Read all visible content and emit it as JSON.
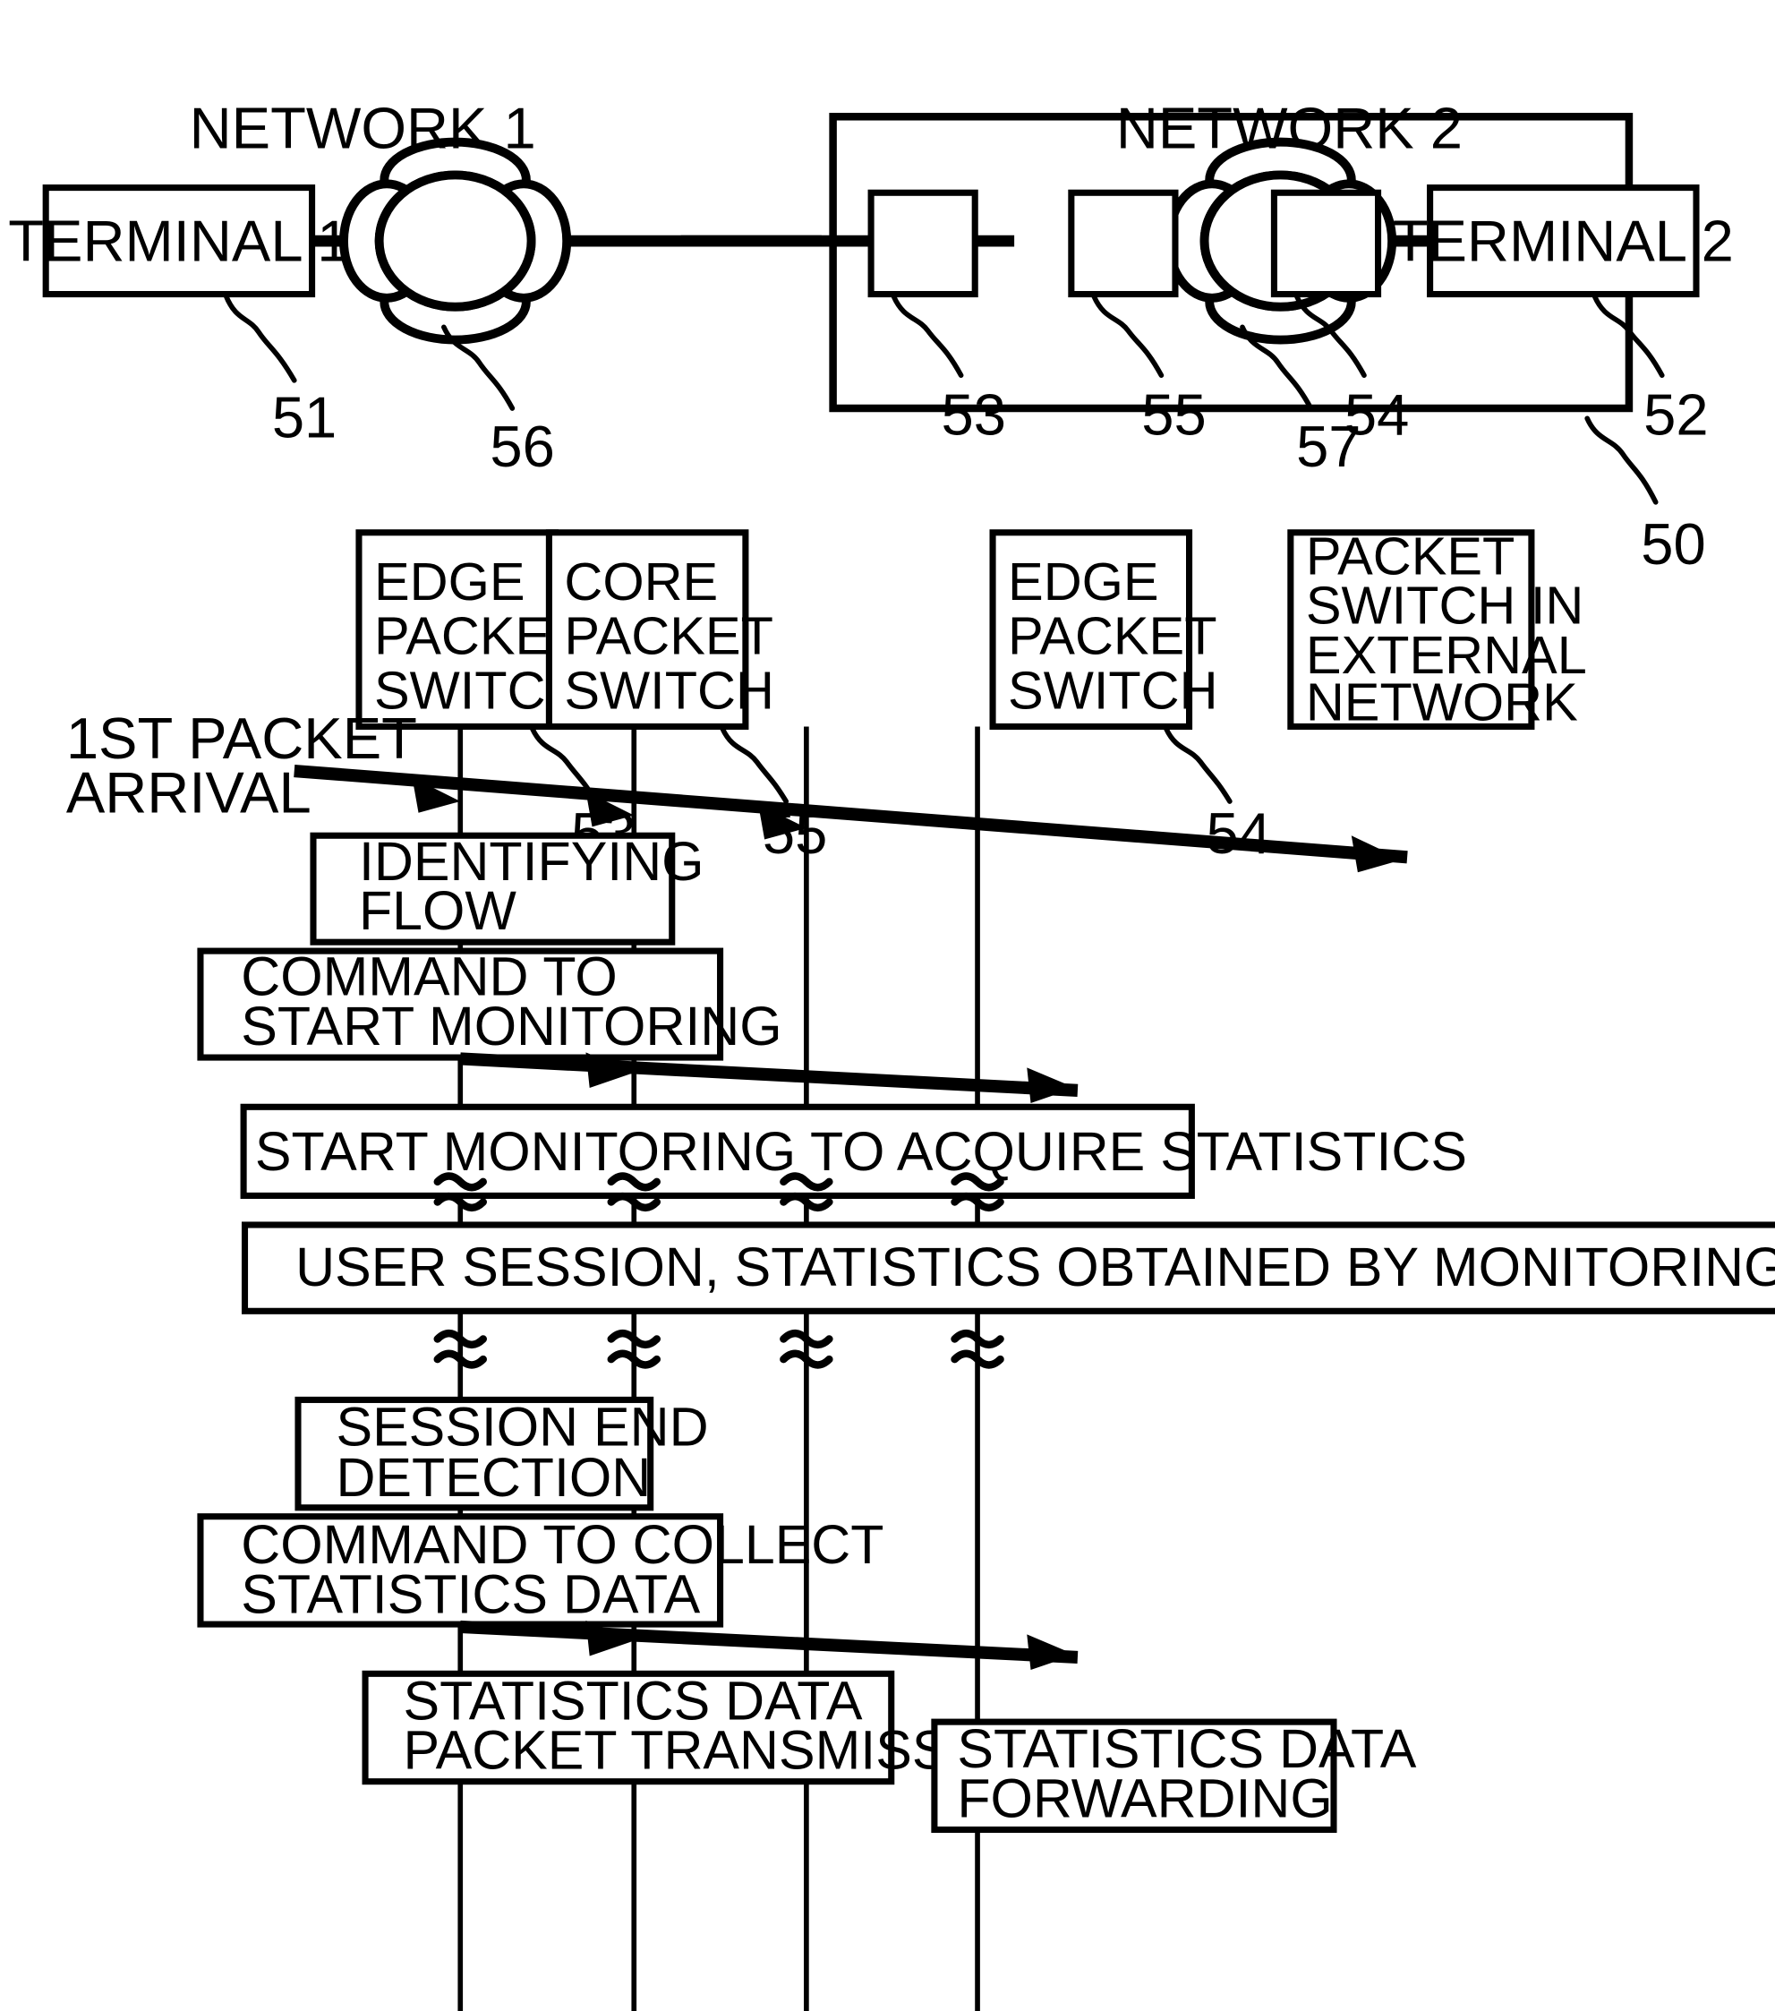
{
  "figure": {
    "top_diagram": {
      "label_network_1": "NETWORK 1",
      "label_network_2": "NETWORK 2",
      "terminal_1": "TERMINAL 1",
      "terminal_2": "TERMINAL 2",
      "ref_terminal_1": "51",
      "ref_terminal_2": "52",
      "ref_cloud_1": "56",
      "ref_cloud_2": "57",
      "ref_switch_edge_left": "53",
      "ref_switch_core": "55",
      "ref_switch_edge_right": "54",
      "ref_network_frame": "50"
    },
    "sequence_diagram": {
      "lifelines": [
        {
          "title": "EDGE\nPACKET\nSWITCH",
          "lines": [
            "EDGE",
            "PACKET",
            "SWITCH"
          ],
          "ref": "53"
        },
        {
          "title": "CORE\nPACKET\nSWITCH",
          "lines": [
            "CORE",
            "PACKET",
            "SWITCH"
          ],
          "ref": "55"
        },
        {
          "title": "EDGE\nPACKET\nSWITCH",
          "lines": [
            "EDGE",
            "PACKET",
            "SWITCH"
          ],
          "ref": "54"
        },
        {
          "title": "PACKET\nSWITCH IN\nEXTERNAL\nNETWORK",
          "lines": [
            "PACKET",
            "SWITCH IN",
            "EXTERNAL",
            "NETWORK"
          ],
          "ref": ""
        }
      ],
      "annotation_first_packet": {
        "line1": "1ST PACKET",
        "line2": "ARRIVAL"
      },
      "steps": [
        {
          "id": "identifying-flow",
          "lines": [
            "IDENTIFYING",
            "FLOW"
          ]
        },
        {
          "id": "command-start-monitoring",
          "lines": [
            "COMMAND TO",
            "START MONITORING"
          ]
        },
        {
          "id": "start-monitoring-statistics",
          "lines": [
            "START MONITORING TO ACQUIRE STATISTICS"
          ]
        },
        {
          "id": "user-session-statistics",
          "lines": [
            "USER SESSION, STATISTICS OBTAINED BY MONITORING"
          ]
        },
        {
          "id": "session-end-detection",
          "lines": [
            "SESSION END",
            "DETECTION"
          ]
        },
        {
          "id": "command-collect-statistics",
          "lines": [
            "COMMAND TO COLLECT",
            "STATISTICS DATA"
          ]
        },
        {
          "id": "statistics-data-packet-transmission",
          "lines": [
            "STATISTICS DATA",
            "PACKET TRANSMISSION"
          ]
        },
        {
          "id": "statistics-data-forwarding",
          "lines": [
            "STATISTICS DATA",
            "FORWARDING"
          ]
        }
      ]
    },
    "colors": {
      "stroke": "#000000",
      "background": "#ffffff"
    }
  }
}
